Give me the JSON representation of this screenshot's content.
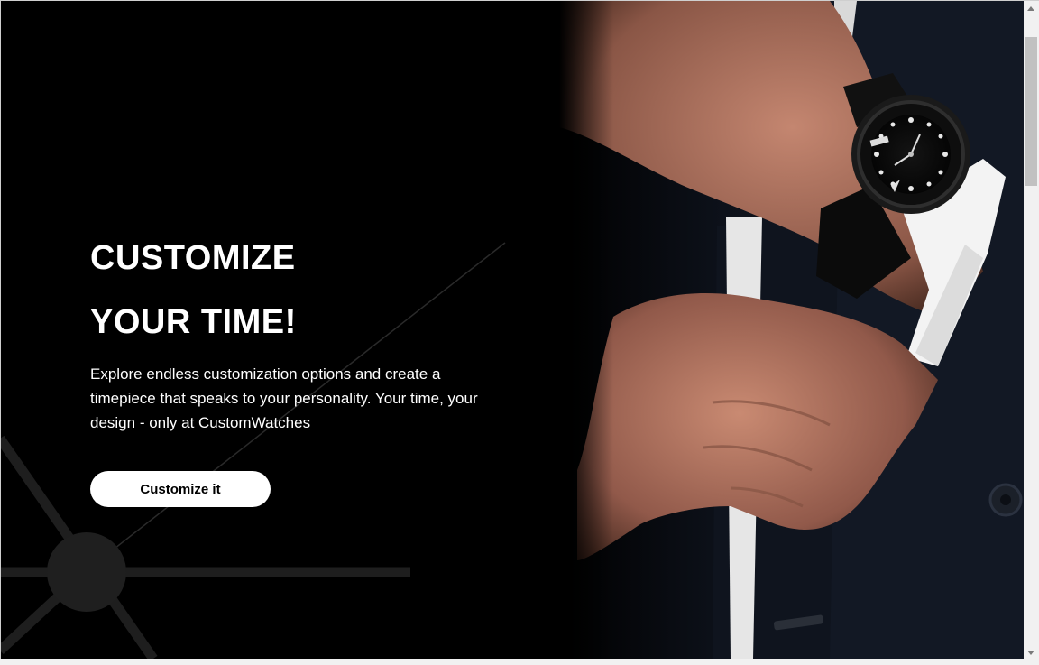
{
  "hero": {
    "title_line1": "CUSTOMIZE",
    "title_line2": "YOUR TIME!",
    "description": "Explore endless customization options and create a timepiece that speaks to your personality. Your time, your design - only at CustomWatches",
    "cta_label": "Customize it",
    "photo_icon": "wrist-watch-photo"
  },
  "colors": {
    "background": "#000000",
    "text": "#ffffff",
    "button_bg": "#ffffff",
    "button_text": "#000000"
  }
}
